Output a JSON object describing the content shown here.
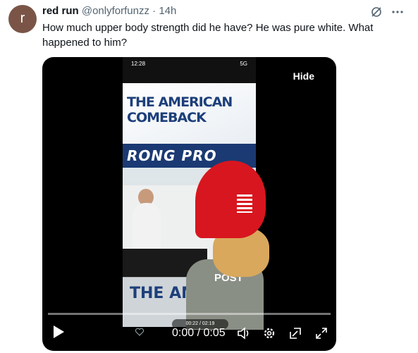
{
  "tweet": {
    "avatar_letter": "r",
    "display_name": "red run",
    "handle": "@onlyforfunzz",
    "separator": "·",
    "time": "14h",
    "text": "How much upper body strength did he have? He was pure white. What happened to him?"
  },
  "video": {
    "hide_label": "Hide",
    "time_display": "0:00 / 0:05",
    "progress_fraction": 0.0,
    "phone_status_time": "12:28",
    "phone_status_right": "5G",
    "overlay_text_top": "THE AMERICAN COMEBACK",
    "overlay_banner": "RONG PRO",
    "overlay_stage": "THE AME",
    "overlay_shirt": "POST",
    "inner_player_time": "00:22 / 02:19",
    "accent_color": "#1d9bf0"
  },
  "icons": [
    "grok-icon",
    "more-icon",
    "play-icon",
    "heart-icon",
    "volume-icon",
    "settings-icon",
    "pip-icon",
    "fullscreen-icon"
  ]
}
